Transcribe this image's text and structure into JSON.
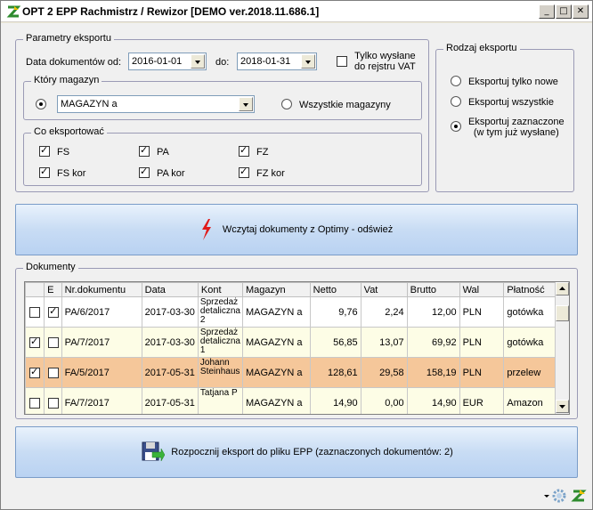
{
  "window": {
    "title": "OPT 2 EPP Rachmistrz / Rewizor [DEMO ver.2018.11.686.1]",
    "min": "_",
    "max": "□",
    "close": "✕"
  },
  "params": {
    "legend": "Parametry eksportu",
    "date_from_label": "Data dokumentów od:",
    "date_from": "2016-01-01",
    "date_to_label": "do:",
    "date_to": "2018-01-31",
    "only_sent_label_1": "Tylko wysłane",
    "only_sent_label_2": "do rejstru VAT",
    "only_sent_checked": false
  },
  "warehouse": {
    "legend": "Który magazyn",
    "selected": "MAGAZYN a",
    "all_label": "Wszystkie magazyny",
    "single_checked": true
  },
  "what": {
    "legend": "Co eksportować",
    "items": [
      {
        "label": "FS",
        "checked": true
      },
      {
        "label": "PA",
        "checked": true
      },
      {
        "label": "FZ",
        "checked": true
      },
      {
        "label": "FS kor",
        "checked": true
      },
      {
        "label": "PA kor",
        "checked": true
      },
      {
        "label": "FZ kor",
        "checked": true
      }
    ]
  },
  "export_type": {
    "legend": "Rodzaj eksportu",
    "opt_new": "Eksportuj tylko nowe",
    "opt_all": "Eksportuj wszystkie",
    "opt_selected_1": "Eksportuj zaznaczone",
    "opt_selected_2": "(w tym już wysłane)"
  },
  "load_button": "Wczytaj dokumenty z Optimy - odśwież",
  "docs": {
    "legend": "Dokumenty",
    "headers": [
      "",
      "E",
      "Nr.dokumentu",
      "Data",
      "Kont",
      "Magazyn",
      "Netto",
      "Vat",
      "Brutto",
      "Wal",
      "Płatność"
    ],
    "rows": [
      {
        "sel": false,
        "e": true,
        "nr": "PA/6/2017",
        "data": "2017-03-30",
        "kont": "Sprzedaż detaliczna 2",
        "mag": "MAGAZYN a",
        "netto": "9,76",
        "vat": "2,24",
        "brutto": "12,00",
        "wal": "PLN",
        "plat": "gotówka",
        "bg": "#ffffff"
      },
      {
        "sel": true,
        "e": false,
        "nr": "PA/7/2017",
        "data": "2017-03-30",
        "kont": "Sprzedaż detaliczna 1",
        "mag": "MAGAZYN a",
        "netto": "56,85",
        "vat": "13,07",
        "brutto": "69,92",
        "wal": "PLN",
        "plat": "gotówka",
        "bg": "#fdfde6"
      },
      {
        "sel": true,
        "e": false,
        "nr": "FA/5/2017",
        "data": "2017-05-31",
        "kont": "Johann Steinhaus",
        "mag": "MAGAZYN a",
        "netto": "128,61",
        "vat": "29,58",
        "brutto": "158,19",
        "wal": "PLN",
        "plat": "przelew",
        "bg": "#f5c79a"
      },
      {
        "sel": false,
        "e": false,
        "nr": "FA/7/2017",
        "data": "2017-05-31",
        "kont": "Tatjana P",
        "mag": "MAGAZYN a",
        "netto": "14,90",
        "vat": "0,00",
        "brutto": "14,90",
        "wal": "EUR",
        "plat": "Amazon",
        "bg": "#fdfde6"
      }
    ]
  },
  "export_button": "Rozpocznij eksport do pliku EPP (zaznaczonych dokumentów: 2)"
}
